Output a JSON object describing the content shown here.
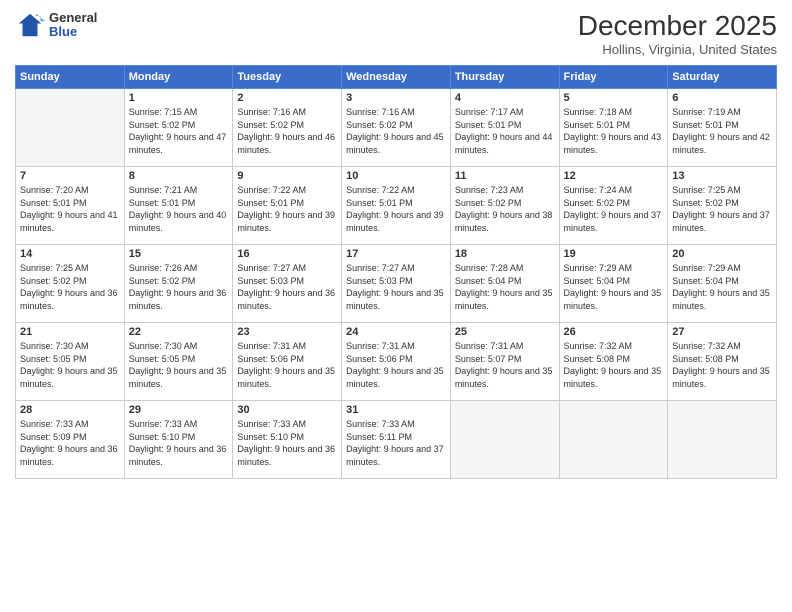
{
  "logo": {
    "general": "General",
    "blue": "Blue"
  },
  "title": "December 2025",
  "location": "Hollins, Virginia, United States",
  "days_of_week": [
    "Sunday",
    "Monday",
    "Tuesday",
    "Wednesday",
    "Thursday",
    "Friday",
    "Saturday"
  ],
  "weeks": [
    [
      {
        "day": "",
        "sunrise": "",
        "sunset": "",
        "daylight": "",
        "empty": true
      },
      {
        "day": "1",
        "sunrise": "Sunrise: 7:15 AM",
        "sunset": "Sunset: 5:02 PM",
        "daylight": "Daylight: 9 hours and 47 minutes."
      },
      {
        "day": "2",
        "sunrise": "Sunrise: 7:16 AM",
        "sunset": "Sunset: 5:02 PM",
        "daylight": "Daylight: 9 hours and 46 minutes."
      },
      {
        "day": "3",
        "sunrise": "Sunrise: 7:16 AM",
        "sunset": "Sunset: 5:02 PM",
        "daylight": "Daylight: 9 hours and 45 minutes."
      },
      {
        "day": "4",
        "sunrise": "Sunrise: 7:17 AM",
        "sunset": "Sunset: 5:01 PM",
        "daylight": "Daylight: 9 hours and 44 minutes."
      },
      {
        "day": "5",
        "sunrise": "Sunrise: 7:18 AM",
        "sunset": "Sunset: 5:01 PM",
        "daylight": "Daylight: 9 hours and 43 minutes."
      },
      {
        "day": "6",
        "sunrise": "Sunrise: 7:19 AM",
        "sunset": "Sunset: 5:01 PM",
        "daylight": "Daylight: 9 hours and 42 minutes."
      }
    ],
    [
      {
        "day": "7",
        "sunrise": "Sunrise: 7:20 AM",
        "sunset": "Sunset: 5:01 PM",
        "daylight": "Daylight: 9 hours and 41 minutes."
      },
      {
        "day": "8",
        "sunrise": "Sunrise: 7:21 AM",
        "sunset": "Sunset: 5:01 PM",
        "daylight": "Daylight: 9 hours and 40 minutes."
      },
      {
        "day": "9",
        "sunrise": "Sunrise: 7:22 AM",
        "sunset": "Sunset: 5:01 PM",
        "daylight": "Daylight: 9 hours and 39 minutes."
      },
      {
        "day": "10",
        "sunrise": "Sunrise: 7:22 AM",
        "sunset": "Sunset: 5:01 PM",
        "daylight": "Daylight: 9 hours and 39 minutes."
      },
      {
        "day": "11",
        "sunrise": "Sunrise: 7:23 AM",
        "sunset": "Sunset: 5:02 PM",
        "daylight": "Daylight: 9 hours and 38 minutes."
      },
      {
        "day": "12",
        "sunrise": "Sunrise: 7:24 AM",
        "sunset": "Sunset: 5:02 PM",
        "daylight": "Daylight: 9 hours and 37 minutes."
      },
      {
        "day": "13",
        "sunrise": "Sunrise: 7:25 AM",
        "sunset": "Sunset: 5:02 PM",
        "daylight": "Daylight: 9 hours and 37 minutes."
      }
    ],
    [
      {
        "day": "14",
        "sunrise": "Sunrise: 7:25 AM",
        "sunset": "Sunset: 5:02 PM",
        "daylight": "Daylight: 9 hours and 36 minutes."
      },
      {
        "day": "15",
        "sunrise": "Sunrise: 7:26 AM",
        "sunset": "Sunset: 5:02 PM",
        "daylight": "Daylight: 9 hours and 36 minutes."
      },
      {
        "day": "16",
        "sunrise": "Sunrise: 7:27 AM",
        "sunset": "Sunset: 5:03 PM",
        "daylight": "Daylight: 9 hours and 36 minutes."
      },
      {
        "day": "17",
        "sunrise": "Sunrise: 7:27 AM",
        "sunset": "Sunset: 5:03 PM",
        "daylight": "Daylight: 9 hours and 35 minutes."
      },
      {
        "day": "18",
        "sunrise": "Sunrise: 7:28 AM",
        "sunset": "Sunset: 5:04 PM",
        "daylight": "Daylight: 9 hours and 35 minutes."
      },
      {
        "day": "19",
        "sunrise": "Sunrise: 7:29 AM",
        "sunset": "Sunset: 5:04 PM",
        "daylight": "Daylight: 9 hours and 35 minutes."
      },
      {
        "day": "20",
        "sunrise": "Sunrise: 7:29 AM",
        "sunset": "Sunset: 5:04 PM",
        "daylight": "Daylight: 9 hours and 35 minutes."
      }
    ],
    [
      {
        "day": "21",
        "sunrise": "Sunrise: 7:30 AM",
        "sunset": "Sunset: 5:05 PM",
        "daylight": "Daylight: 9 hours and 35 minutes."
      },
      {
        "day": "22",
        "sunrise": "Sunrise: 7:30 AM",
        "sunset": "Sunset: 5:05 PM",
        "daylight": "Daylight: 9 hours and 35 minutes."
      },
      {
        "day": "23",
        "sunrise": "Sunrise: 7:31 AM",
        "sunset": "Sunset: 5:06 PM",
        "daylight": "Daylight: 9 hours and 35 minutes."
      },
      {
        "day": "24",
        "sunrise": "Sunrise: 7:31 AM",
        "sunset": "Sunset: 5:06 PM",
        "daylight": "Daylight: 9 hours and 35 minutes."
      },
      {
        "day": "25",
        "sunrise": "Sunrise: 7:31 AM",
        "sunset": "Sunset: 5:07 PM",
        "daylight": "Daylight: 9 hours and 35 minutes."
      },
      {
        "day": "26",
        "sunrise": "Sunrise: 7:32 AM",
        "sunset": "Sunset: 5:08 PM",
        "daylight": "Daylight: 9 hours and 35 minutes."
      },
      {
        "day": "27",
        "sunrise": "Sunrise: 7:32 AM",
        "sunset": "Sunset: 5:08 PM",
        "daylight": "Daylight: 9 hours and 35 minutes."
      }
    ],
    [
      {
        "day": "28",
        "sunrise": "Sunrise: 7:33 AM",
        "sunset": "Sunset: 5:09 PM",
        "daylight": "Daylight: 9 hours and 36 minutes."
      },
      {
        "day": "29",
        "sunrise": "Sunrise: 7:33 AM",
        "sunset": "Sunset: 5:10 PM",
        "daylight": "Daylight: 9 hours and 36 minutes."
      },
      {
        "day": "30",
        "sunrise": "Sunrise: 7:33 AM",
        "sunset": "Sunset: 5:10 PM",
        "daylight": "Daylight: 9 hours and 36 minutes."
      },
      {
        "day": "31",
        "sunrise": "Sunrise: 7:33 AM",
        "sunset": "Sunset: 5:11 PM",
        "daylight": "Daylight: 9 hours and 37 minutes."
      },
      {
        "day": "",
        "sunrise": "",
        "sunset": "",
        "daylight": "",
        "empty": true
      },
      {
        "day": "",
        "sunrise": "",
        "sunset": "",
        "daylight": "",
        "empty": true
      },
      {
        "day": "",
        "sunrise": "",
        "sunset": "",
        "daylight": "",
        "empty": true
      }
    ]
  ]
}
